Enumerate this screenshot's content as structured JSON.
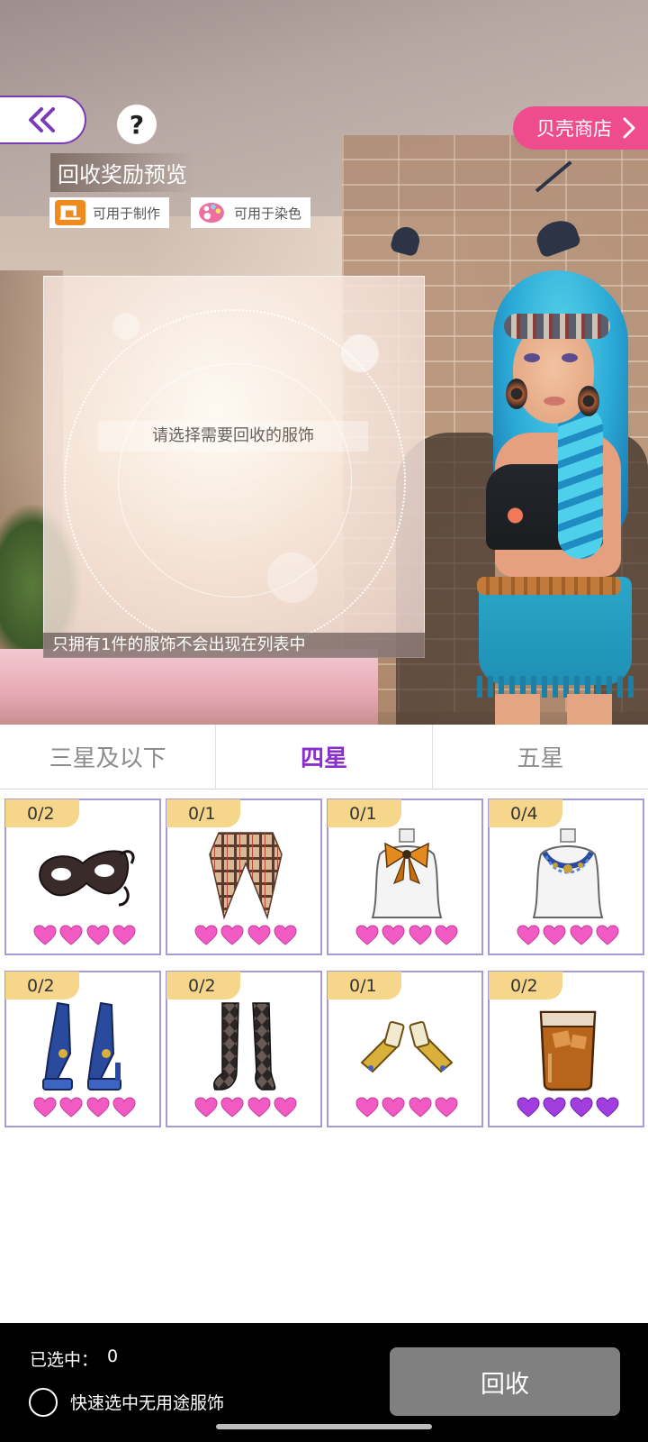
{
  "header": {
    "title": "回收奖励预览",
    "shop_label": "贝壳商店",
    "help_label": "?"
  },
  "tags": [
    {
      "label": "可用于制作",
      "icon": "sewing-machine-icon",
      "color": "#f08a1e"
    },
    {
      "label": "可用于染色",
      "icon": "palette-icon",
      "color": "#ec6fa0"
    }
  ],
  "preview": {
    "hint": "请选择需要回收的服饰",
    "note": "只拥有1件的服饰不会出现在列表中"
  },
  "tabs": [
    {
      "label": "三星及以下",
      "active": false
    },
    {
      "label": "四星",
      "active": true
    },
    {
      "label": "五星",
      "active": false
    }
  ],
  "items": [
    {
      "count": "0/2",
      "name": "lace-mask",
      "hearts": 4,
      "heart_color": "#f25bc4"
    },
    {
      "count": "0/1",
      "name": "plaid-scarf",
      "hearts": 4,
      "heart_color": "#f25bc4"
    },
    {
      "count": "0/1",
      "name": "bow-neck-scarf",
      "hearts": 4,
      "heart_color": "#f25bc4"
    },
    {
      "count": "0/4",
      "name": "blue-beaded-necklace",
      "hearts": 4,
      "heart_color": "#f25bc4"
    },
    {
      "count": "0/2",
      "name": "blue-platform-heels",
      "hearts": 4,
      "heart_color": "#f25bc4"
    },
    {
      "count": "0/2",
      "name": "argyle-stockings",
      "hearts": 4,
      "heart_color": "#f25bc4"
    },
    {
      "count": "0/1",
      "name": "gold-wrist-cuffs",
      "hearts": 4,
      "heart_color": "#f25bc4"
    },
    {
      "count": "0/2",
      "name": "whiskey-glass",
      "hearts": 4,
      "heart_color": "#a23ee0"
    }
  ],
  "bottom": {
    "selected_label": "已选中：",
    "selected_count": "0",
    "quick_select_label": "快速选中无用途服饰",
    "recycle_label": "回收"
  },
  "colors": {
    "accent_purple": "#8a2fce",
    "shop_pink": "#ee4c8d",
    "count_badge": "#f6d68b",
    "card_border": "#a79ad8"
  }
}
